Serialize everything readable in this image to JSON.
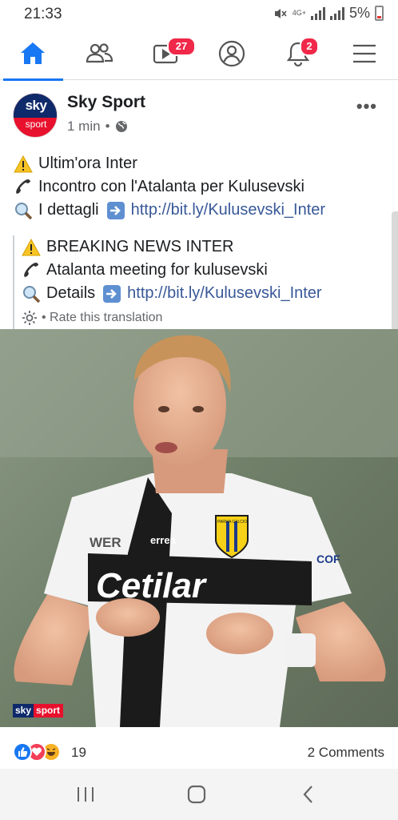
{
  "status_bar": {
    "time": "21:33",
    "network": "4G+",
    "battery": "5%"
  },
  "nav": {
    "items": [
      {
        "name": "home",
        "icon": "home-icon",
        "active": true
      },
      {
        "name": "friends",
        "icon": "friends-icon"
      },
      {
        "name": "watch",
        "icon": "video-icon",
        "badge": "27"
      },
      {
        "name": "profile",
        "icon": "profile-icon"
      },
      {
        "name": "notifications",
        "icon": "bell-icon",
        "badge": "2"
      },
      {
        "name": "menu",
        "icon": "hamburger-icon"
      }
    ],
    "accent": "#1877f2",
    "badge_color": "#f02849"
  },
  "post": {
    "avatar_top": "sky",
    "avatar_bottom": "sport",
    "page_name": "Sky Sport",
    "time": "1 min",
    "separator": "•",
    "more": "•••",
    "lines": [
      {
        "emoji": "warning-icon",
        "text": "Ultim'ora Inter"
      },
      {
        "emoji": "phone-icon",
        "text": "Incontro con l'Atalanta per Kulusevski"
      },
      {
        "emoji": "magnifier-icon",
        "text": "I dettagli",
        "arrow": "arrow-right-icon",
        "link": "http://bit.ly/Kulusevski_Inter"
      }
    ],
    "translation": {
      "lines": [
        {
          "emoji": "warning-icon",
          "text": "BREAKING NEWS INTER"
        },
        {
          "emoji": "phone-icon",
          "text": "Atalanta meeting for kulusevski"
        },
        {
          "emoji": "magnifier-icon",
          "text": "Details",
          "arrow": "arrow-right-icon",
          "link": "http://bit.ly/Kulusevski_Inter"
        }
      ],
      "rate_label": "Rate this translation"
    },
    "photo": {
      "watermark_sky": "sky",
      "watermark_sport": "sport",
      "shirt_sponsor": "Cetilar",
      "shirt_brand": "errea",
      "shirt_sleeve": "WER",
      "badge_text": "PARMA CALCIO",
      "sleeve_sponsor": "COF"
    },
    "reactions": {
      "count": "19",
      "comments": "2 Comments",
      "types": [
        "like",
        "love",
        "haha"
      ]
    }
  },
  "android_nav": [
    "recents-button",
    "home-button",
    "back-button"
  ]
}
